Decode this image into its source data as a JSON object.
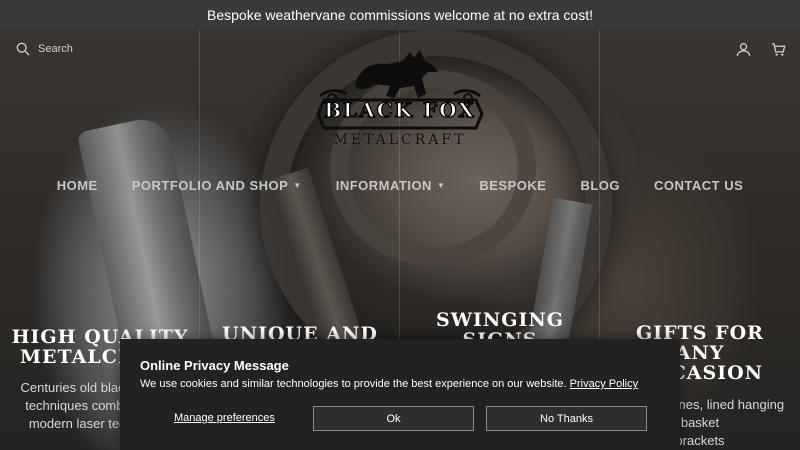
{
  "announcement": "Bespoke weathervane commissions welcome at no extra cost!",
  "search": {
    "placeholder": "Search"
  },
  "header_icons": [
    "user-icon",
    "cart-icon"
  ],
  "logo": {
    "name": "BLACK FOX",
    "tagline": "METALCRAFT"
  },
  "nav": [
    {
      "label": "HOME",
      "has_dropdown": false
    },
    {
      "label": "PORTFOLIO AND SHOP",
      "has_dropdown": true
    },
    {
      "label": "INFORMATION",
      "has_dropdown": true
    },
    {
      "label": "BESPOKE",
      "has_dropdown": false
    },
    {
      "label": "BLOG",
      "has_dropdown": false
    },
    {
      "label": "CONTACT US",
      "has_dropdown": false
    }
  ],
  "columns": [
    {
      "title_line1": "HIGH QUALITY",
      "title_line2": "METALCRAFT",
      "text_line1": "Centuries old blacksmithing",
      "text_line2": "techniques combined with",
      "text_line3": "modern laser technology"
    },
    {
      "title_line1": "UNIQUE AND",
      "title_line2": ""
    },
    {
      "title_line1": "SWINGING",
      "title_line2": "SIGNS"
    },
    {
      "title_line1": "GIFTS FOR",
      "title_line2": "ANY",
      "title_line3": "OCCASION",
      "text_line1": "Weathervanes, lined hanging basket",
      "text_line2": "brackets"
    }
  ],
  "cookie": {
    "title": "Online Privacy Message",
    "message": "We use cookies and similar technologies to provide the best experience on our website.",
    "policy_link": "Privacy Policy",
    "manage": "Manage preferences",
    "ok": "Ok",
    "no_thanks": "No Thanks"
  },
  "colors": {
    "announcement_bg": "#3a3a3a",
    "nav_text": "#c7c7c7",
    "dialog_bg": "#222222"
  }
}
